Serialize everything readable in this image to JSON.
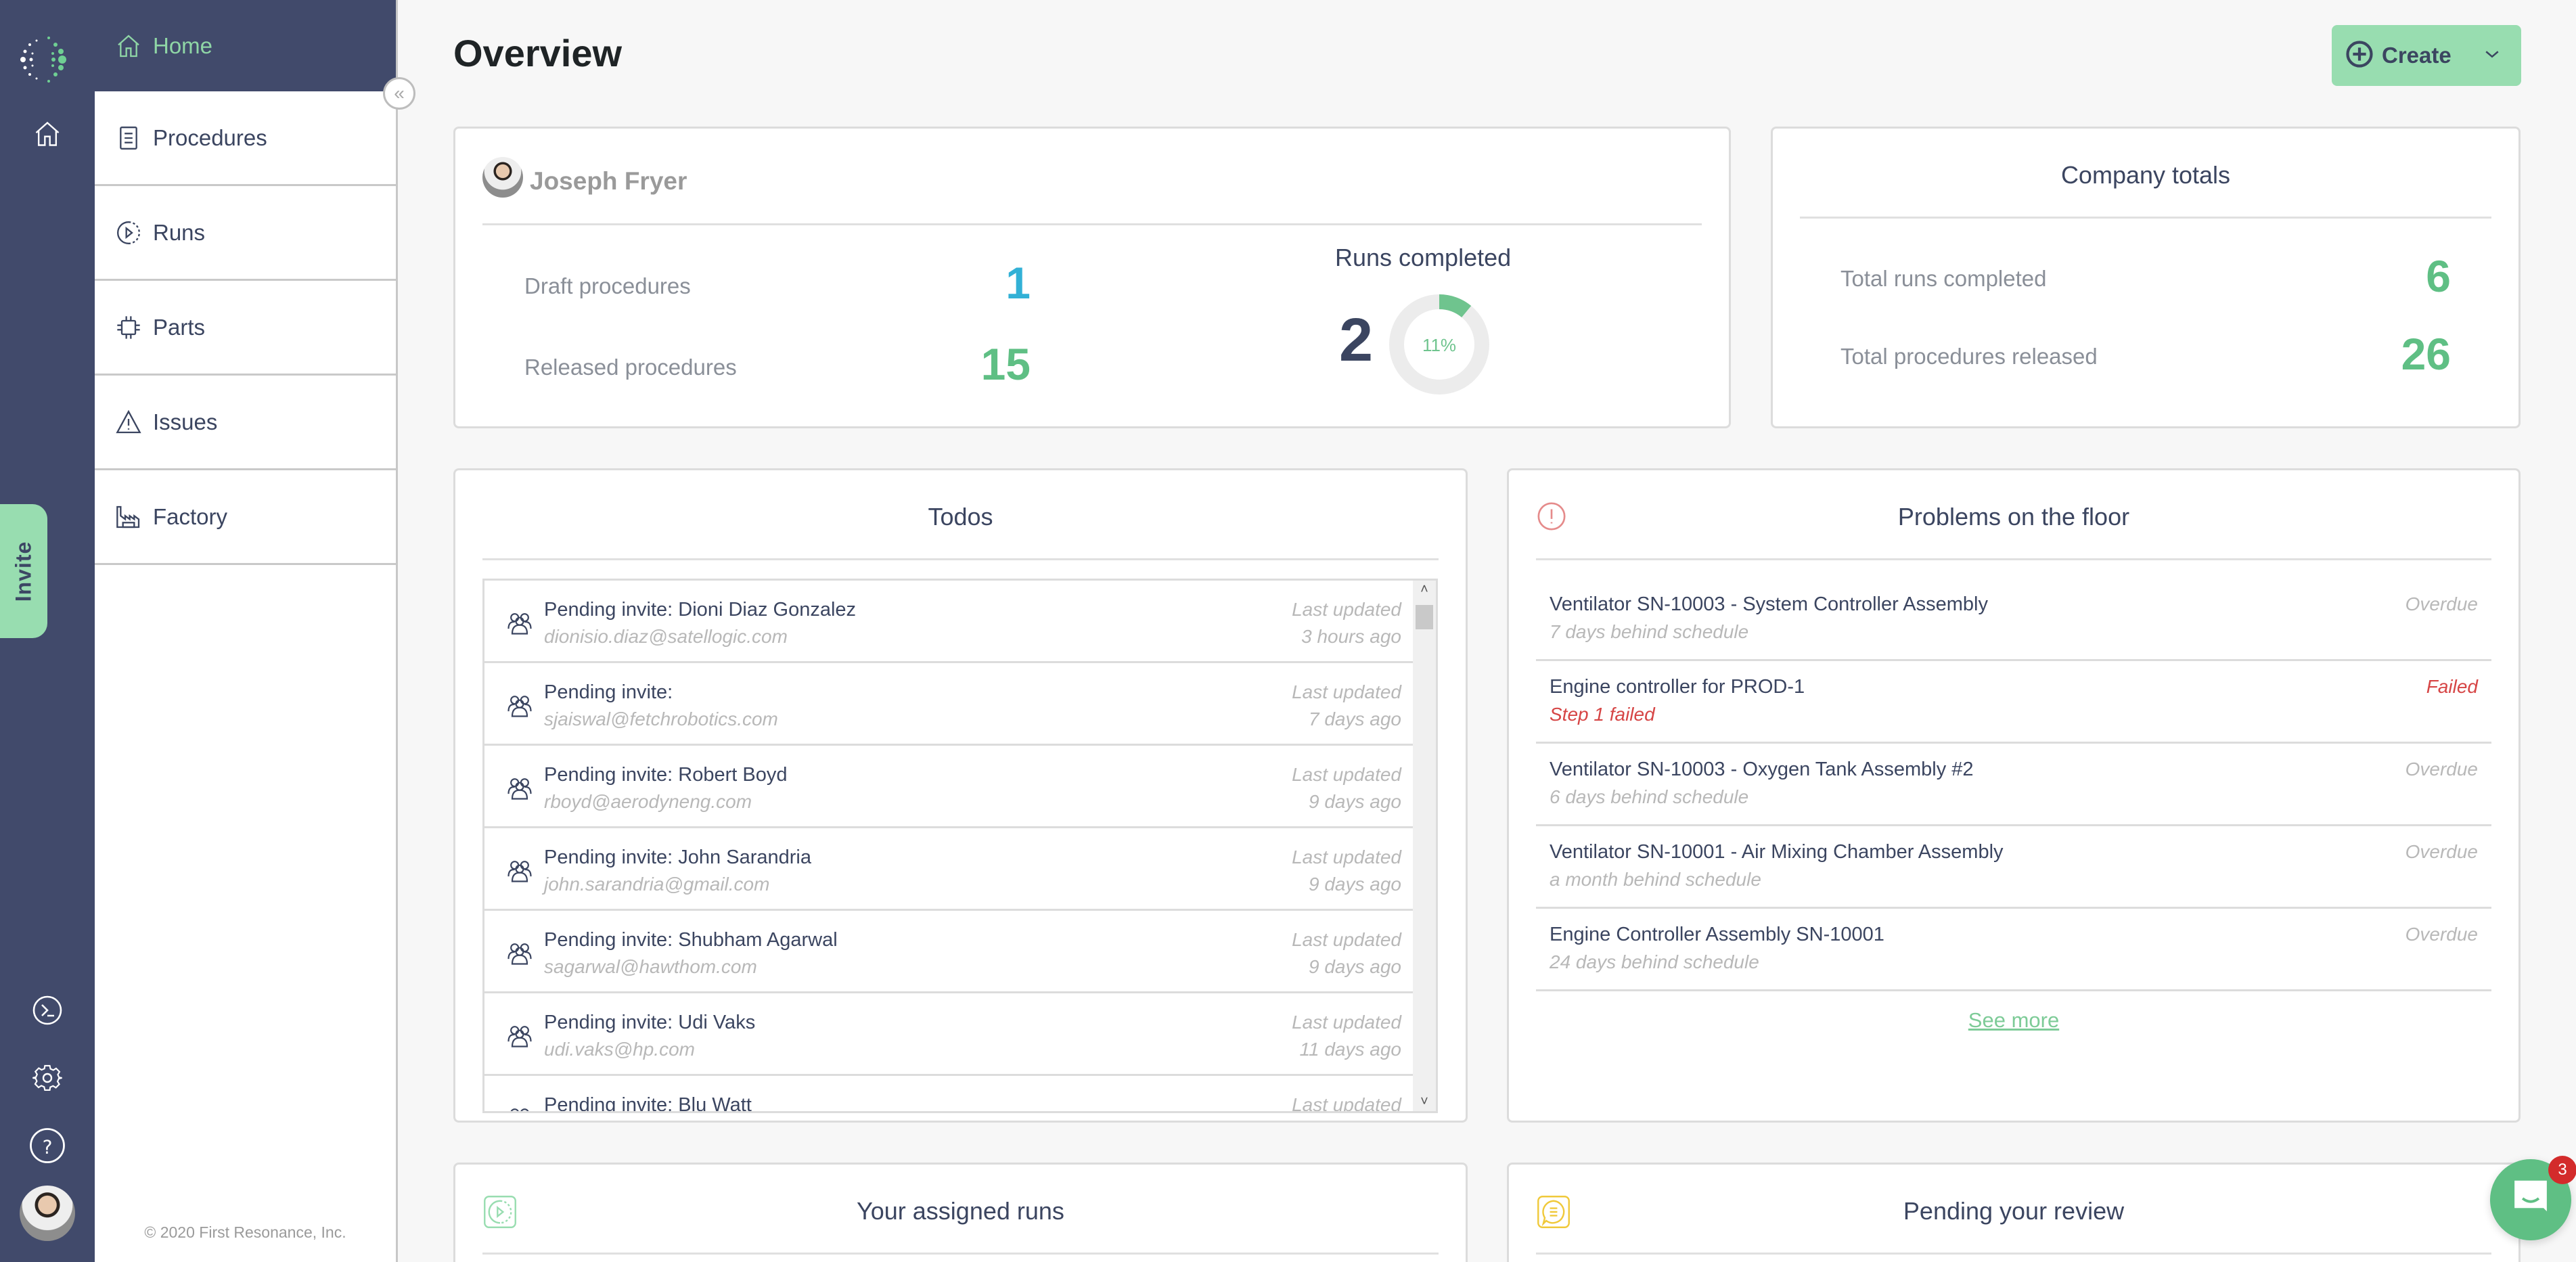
{
  "rail": {
    "icons": [
      "logo-icon",
      "home-icon",
      "terminal-icon",
      "gear-icon",
      "help-icon"
    ],
    "invite_label": "Invite"
  },
  "nav": {
    "home_label": "Home",
    "items": [
      {
        "label": "Procedures",
        "icon": "document-icon"
      },
      {
        "label": "Runs",
        "icon": "run-icon"
      },
      {
        "label": "Parts",
        "icon": "chip-icon"
      },
      {
        "label": "Issues",
        "icon": "warning-icon"
      },
      {
        "label": "Factory",
        "icon": "factory-icon"
      }
    ],
    "footer": "© 2020 First Resonance, Inc.",
    "collapse_icon": "«"
  },
  "header": {
    "title": "Overview",
    "create_label": "Create"
  },
  "user_card": {
    "name": "Joseph Fryer",
    "draft_label": "Draft procedures",
    "draft_value": "1",
    "released_label": "Released procedures",
    "released_value": "15",
    "runs_title": "Runs completed",
    "runs_value": "2",
    "runs_percent_label": "11%",
    "runs_percent": 11
  },
  "company": {
    "title": "Company totals",
    "runs_label": "Total runs completed",
    "runs_value": "6",
    "procedures_label": "Total procedures released",
    "procedures_value": "26"
  },
  "todos": {
    "title": "Todos",
    "items": [
      {
        "title": "Pending invite: Dioni Diaz Gonzalez",
        "email": "dionisio.diaz@satellogic.com",
        "meta": "Last updated",
        "time": "3 hours ago"
      },
      {
        "title": "Pending invite:",
        "email": "sjaiswal@fetchrobotics.com",
        "meta": "Last updated",
        "time": "7 days ago"
      },
      {
        "title": "Pending invite: Robert Boyd",
        "email": "rboyd@aerodyneng.com",
        "meta": "Last updated",
        "time": "9 days ago"
      },
      {
        "title": "Pending invite: John Sarandria",
        "email": "john.sarandria@gmail.com",
        "meta": "Last updated",
        "time": "9 days ago"
      },
      {
        "title": "Pending invite: Shubham Agarwal",
        "email": "sagarwal@hawthom.com",
        "meta": "Last updated",
        "time": "9 days ago"
      },
      {
        "title": "Pending invite: Udi Vaks",
        "email": "udi.vaks@hp.com",
        "meta": "Last updated",
        "time": "11 days ago"
      },
      {
        "title": "Pending invite: Blu Watt",
        "email": "",
        "meta": "Last updated",
        "time": ""
      }
    ]
  },
  "problems": {
    "title": "Problems on the floor",
    "items": [
      {
        "title": "Ventilator SN-10003 - System Controller Assembly",
        "sub": "7 days behind schedule",
        "status": "Overdue",
        "kind": "overdue"
      },
      {
        "title": "Engine controller for PROD-1",
        "sub": "Step 1 failed",
        "status": "Failed",
        "kind": "failed"
      },
      {
        "title": "Ventilator SN-10003 - Oxygen Tank Assembly #2",
        "sub": "6 days behind schedule",
        "status": "Overdue",
        "kind": "overdue"
      },
      {
        "title": "Ventilator SN-10001 - Air Mixing Chamber Assembly",
        "sub": "a month behind schedule",
        "status": "Overdue",
        "kind": "overdue"
      },
      {
        "title": "Engine Controller Assembly SN-10001",
        "sub": "24 days behind schedule",
        "status": "Overdue",
        "kind": "overdue"
      }
    ],
    "see_more": "See more"
  },
  "assigned_runs": {
    "title": "Your assigned runs"
  },
  "pending_review": {
    "title": "Pending your review"
  },
  "chat": {
    "badge": "3"
  },
  "colors": {
    "rail": "#414a6b",
    "accent_green": "#5fbf84",
    "light_green": "#98ddb0",
    "draft_blue": "#32b1d6",
    "failed_red": "#d64545",
    "muted": "#b8b8b8"
  }
}
